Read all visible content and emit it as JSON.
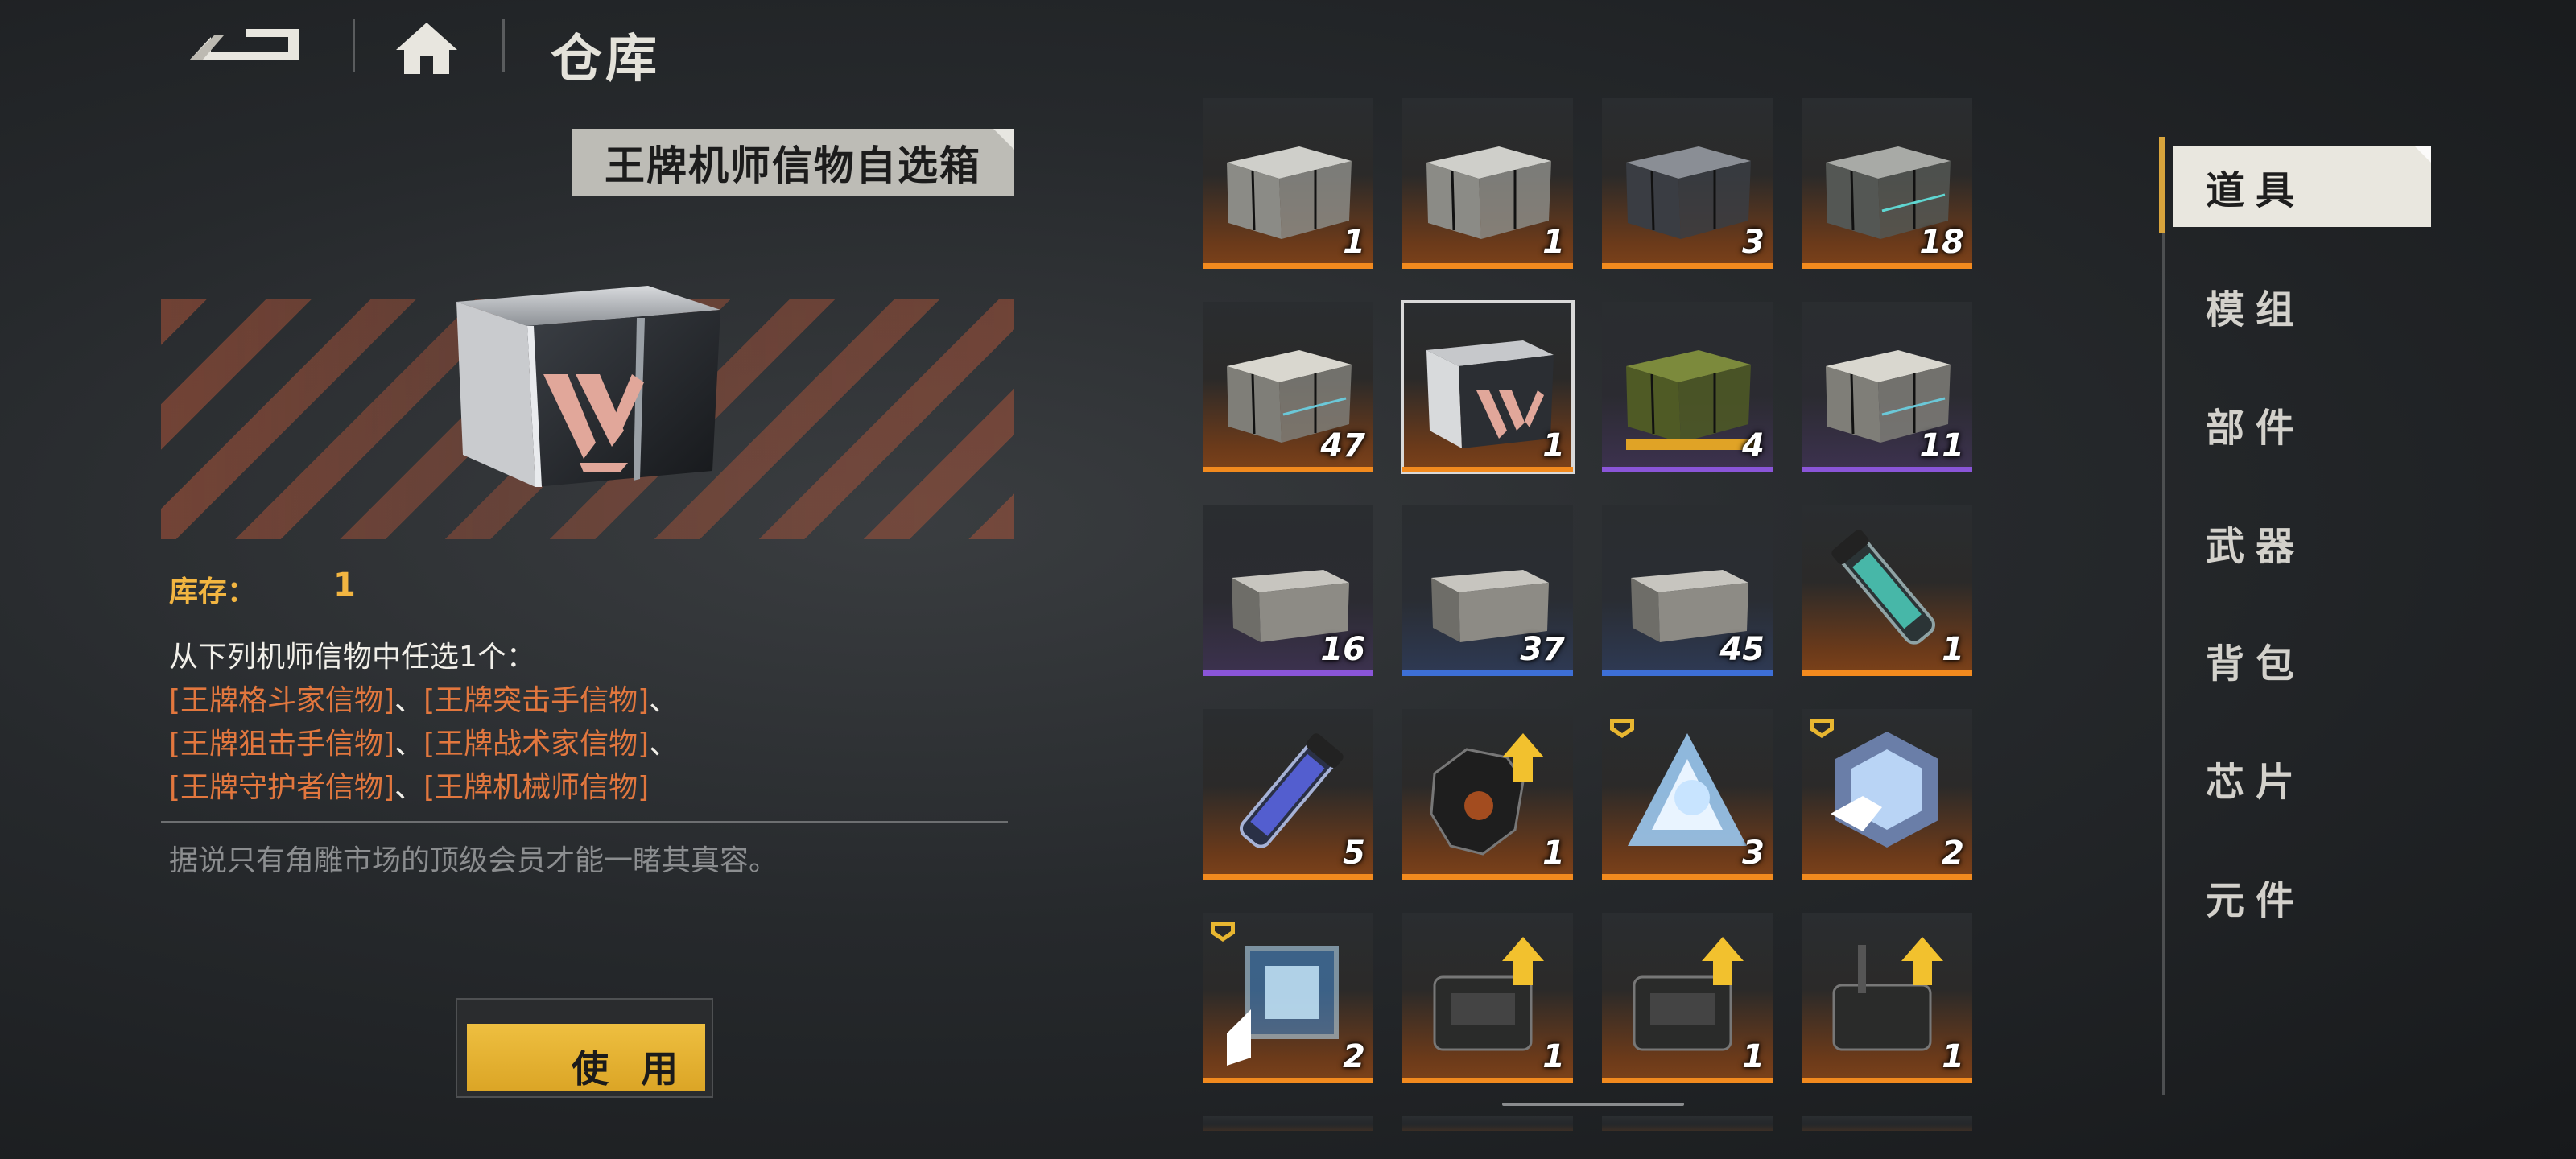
{
  "header": {
    "title": "仓库"
  },
  "detail": {
    "item_name": "王牌机师信物自选箱",
    "stock_label": "库存：",
    "stock_value": "1",
    "description_intro": "从下列机师信物中任选1个：",
    "options": [
      "[王牌格斗家信物]",
      "[王牌突击手信物]",
      "[王牌狙击手信物]",
      "[王牌战术家信物]",
      "[王牌守护者信物]",
      "[王牌机械师信物]"
    ],
    "separator": "、",
    "flavor": "据说只有角雕市场的顶级会员才能一睹其真容。",
    "use_button_label": "使 用"
  },
  "categories": [
    "道具",
    "模组",
    "部件",
    "武器",
    "背包",
    "芯片",
    "元件"
  ],
  "active_category": "道具",
  "inventory": [
    {
      "art": "silver-crate-icon",
      "qty": "1",
      "rarity": "orange"
    },
    {
      "art": "silver-crate-icon",
      "qty": "1",
      "rarity": "orange"
    },
    {
      "art": "dark-crate-icon",
      "qty": "3",
      "rarity": "orange"
    },
    {
      "art": "teal-crate-icon",
      "qty": "18",
      "rarity": "orange"
    },
    {
      "art": "steel-crate-icon",
      "qty": "47",
      "rarity": "orange"
    },
    {
      "art": "ace-box-icon",
      "qty": "1",
      "rarity": "orange",
      "selected": true
    },
    {
      "art": "green-crate-icon",
      "qty": "4",
      "rarity": "purple"
    },
    {
      "art": "steel-crate-icon",
      "qty": "11",
      "rarity": "purple"
    },
    {
      "art": "small-crate-icon",
      "qty": "16",
      "rarity": "purple"
    },
    {
      "art": "small-crate-icon",
      "qty": "37",
      "rarity": "blue"
    },
    {
      "art": "small-crate-icon",
      "qty": "45",
      "rarity": "blue"
    },
    {
      "art": "teal-vial-icon",
      "qty": "1",
      "rarity": "orange"
    },
    {
      "art": "blue-vial-icon",
      "qty": "5",
      "rarity": "orange"
    },
    {
      "art": "scrap-upgrade-icon",
      "qty": "1",
      "rarity": "orange"
    },
    {
      "art": "crystal-triangle-icon",
      "qty": "3",
      "rarity": "orange",
      "badge": true
    },
    {
      "art": "crystal-hex-icon",
      "qty": "2",
      "rarity": "orange",
      "badge": true
    },
    {
      "art": "crystal-cube-icon",
      "qty": "2",
      "rarity": "orange",
      "badge": true
    },
    {
      "art": "engine-upgrade-icon",
      "qty": "1",
      "rarity": "orange"
    },
    {
      "art": "engine-upgrade-icon",
      "qty": "1",
      "rarity": "orange"
    },
    {
      "art": "turret-upgrade-icon",
      "qty": "1",
      "rarity": "orange"
    }
  ],
  "colors": {
    "accent_gold": "#f2b541",
    "option_orange": "#e2773e",
    "rarity_orange": "#f28a1e",
    "rarity_purple": "#8a55d8",
    "rarity_blue": "#3d6fd6"
  }
}
